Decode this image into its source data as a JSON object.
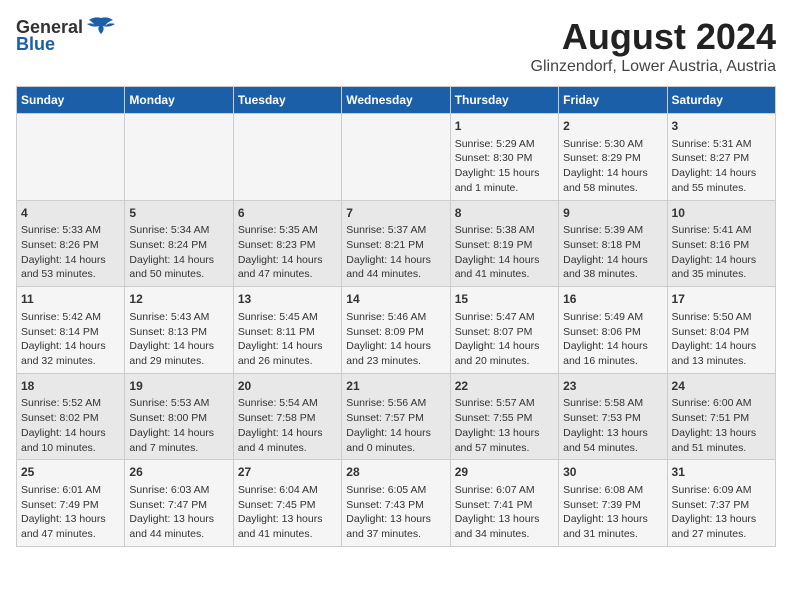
{
  "header": {
    "logo": {
      "general": "General",
      "blue": "Blue"
    },
    "title": "August 2024",
    "subtitle": "Glinzendorf, Lower Austria, Austria"
  },
  "calendar": {
    "days_of_week": [
      "Sunday",
      "Monday",
      "Tuesday",
      "Wednesday",
      "Thursday",
      "Friday",
      "Saturday"
    ],
    "weeks": [
      [
        {
          "day": "",
          "content": ""
        },
        {
          "day": "",
          "content": ""
        },
        {
          "day": "",
          "content": ""
        },
        {
          "day": "",
          "content": ""
        },
        {
          "day": "1",
          "content": "Sunrise: 5:29 AM\nSunset: 8:30 PM\nDaylight: 15 hours\nand 1 minute."
        },
        {
          "day": "2",
          "content": "Sunrise: 5:30 AM\nSunset: 8:29 PM\nDaylight: 14 hours\nand 58 minutes."
        },
        {
          "day": "3",
          "content": "Sunrise: 5:31 AM\nSunset: 8:27 PM\nDaylight: 14 hours\nand 55 minutes."
        }
      ],
      [
        {
          "day": "4",
          "content": "Sunrise: 5:33 AM\nSunset: 8:26 PM\nDaylight: 14 hours\nand 53 minutes."
        },
        {
          "day": "5",
          "content": "Sunrise: 5:34 AM\nSunset: 8:24 PM\nDaylight: 14 hours\nand 50 minutes."
        },
        {
          "day": "6",
          "content": "Sunrise: 5:35 AM\nSunset: 8:23 PM\nDaylight: 14 hours\nand 47 minutes."
        },
        {
          "day": "7",
          "content": "Sunrise: 5:37 AM\nSunset: 8:21 PM\nDaylight: 14 hours\nand 44 minutes."
        },
        {
          "day": "8",
          "content": "Sunrise: 5:38 AM\nSunset: 8:19 PM\nDaylight: 14 hours\nand 41 minutes."
        },
        {
          "day": "9",
          "content": "Sunrise: 5:39 AM\nSunset: 8:18 PM\nDaylight: 14 hours\nand 38 minutes."
        },
        {
          "day": "10",
          "content": "Sunrise: 5:41 AM\nSunset: 8:16 PM\nDaylight: 14 hours\nand 35 minutes."
        }
      ],
      [
        {
          "day": "11",
          "content": "Sunrise: 5:42 AM\nSunset: 8:14 PM\nDaylight: 14 hours\nand 32 minutes."
        },
        {
          "day": "12",
          "content": "Sunrise: 5:43 AM\nSunset: 8:13 PM\nDaylight: 14 hours\nand 29 minutes."
        },
        {
          "day": "13",
          "content": "Sunrise: 5:45 AM\nSunset: 8:11 PM\nDaylight: 14 hours\nand 26 minutes."
        },
        {
          "day": "14",
          "content": "Sunrise: 5:46 AM\nSunset: 8:09 PM\nDaylight: 14 hours\nand 23 minutes."
        },
        {
          "day": "15",
          "content": "Sunrise: 5:47 AM\nSunset: 8:07 PM\nDaylight: 14 hours\nand 20 minutes."
        },
        {
          "day": "16",
          "content": "Sunrise: 5:49 AM\nSunset: 8:06 PM\nDaylight: 14 hours\nand 16 minutes."
        },
        {
          "day": "17",
          "content": "Sunrise: 5:50 AM\nSunset: 8:04 PM\nDaylight: 14 hours\nand 13 minutes."
        }
      ],
      [
        {
          "day": "18",
          "content": "Sunrise: 5:52 AM\nSunset: 8:02 PM\nDaylight: 14 hours\nand 10 minutes."
        },
        {
          "day": "19",
          "content": "Sunrise: 5:53 AM\nSunset: 8:00 PM\nDaylight: 14 hours\nand 7 minutes."
        },
        {
          "day": "20",
          "content": "Sunrise: 5:54 AM\nSunset: 7:58 PM\nDaylight: 14 hours\nand 4 minutes."
        },
        {
          "day": "21",
          "content": "Sunrise: 5:56 AM\nSunset: 7:57 PM\nDaylight: 14 hours\nand 0 minutes."
        },
        {
          "day": "22",
          "content": "Sunrise: 5:57 AM\nSunset: 7:55 PM\nDaylight: 13 hours\nand 57 minutes."
        },
        {
          "day": "23",
          "content": "Sunrise: 5:58 AM\nSunset: 7:53 PM\nDaylight: 13 hours\nand 54 minutes."
        },
        {
          "day": "24",
          "content": "Sunrise: 6:00 AM\nSunset: 7:51 PM\nDaylight: 13 hours\nand 51 minutes."
        }
      ],
      [
        {
          "day": "25",
          "content": "Sunrise: 6:01 AM\nSunset: 7:49 PM\nDaylight: 13 hours\nand 47 minutes."
        },
        {
          "day": "26",
          "content": "Sunrise: 6:03 AM\nSunset: 7:47 PM\nDaylight: 13 hours\nand 44 minutes."
        },
        {
          "day": "27",
          "content": "Sunrise: 6:04 AM\nSunset: 7:45 PM\nDaylight: 13 hours\nand 41 minutes."
        },
        {
          "day": "28",
          "content": "Sunrise: 6:05 AM\nSunset: 7:43 PM\nDaylight: 13 hours\nand 37 minutes."
        },
        {
          "day": "29",
          "content": "Sunrise: 6:07 AM\nSunset: 7:41 PM\nDaylight: 13 hours\nand 34 minutes."
        },
        {
          "day": "30",
          "content": "Sunrise: 6:08 AM\nSunset: 7:39 PM\nDaylight: 13 hours\nand 31 minutes."
        },
        {
          "day": "31",
          "content": "Sunrise: 6:09 AM\nSunset: 7:37 PM\nDaylight: 13 hours\nand 27 minutes."
        }
      ]
    ]
  }
}
